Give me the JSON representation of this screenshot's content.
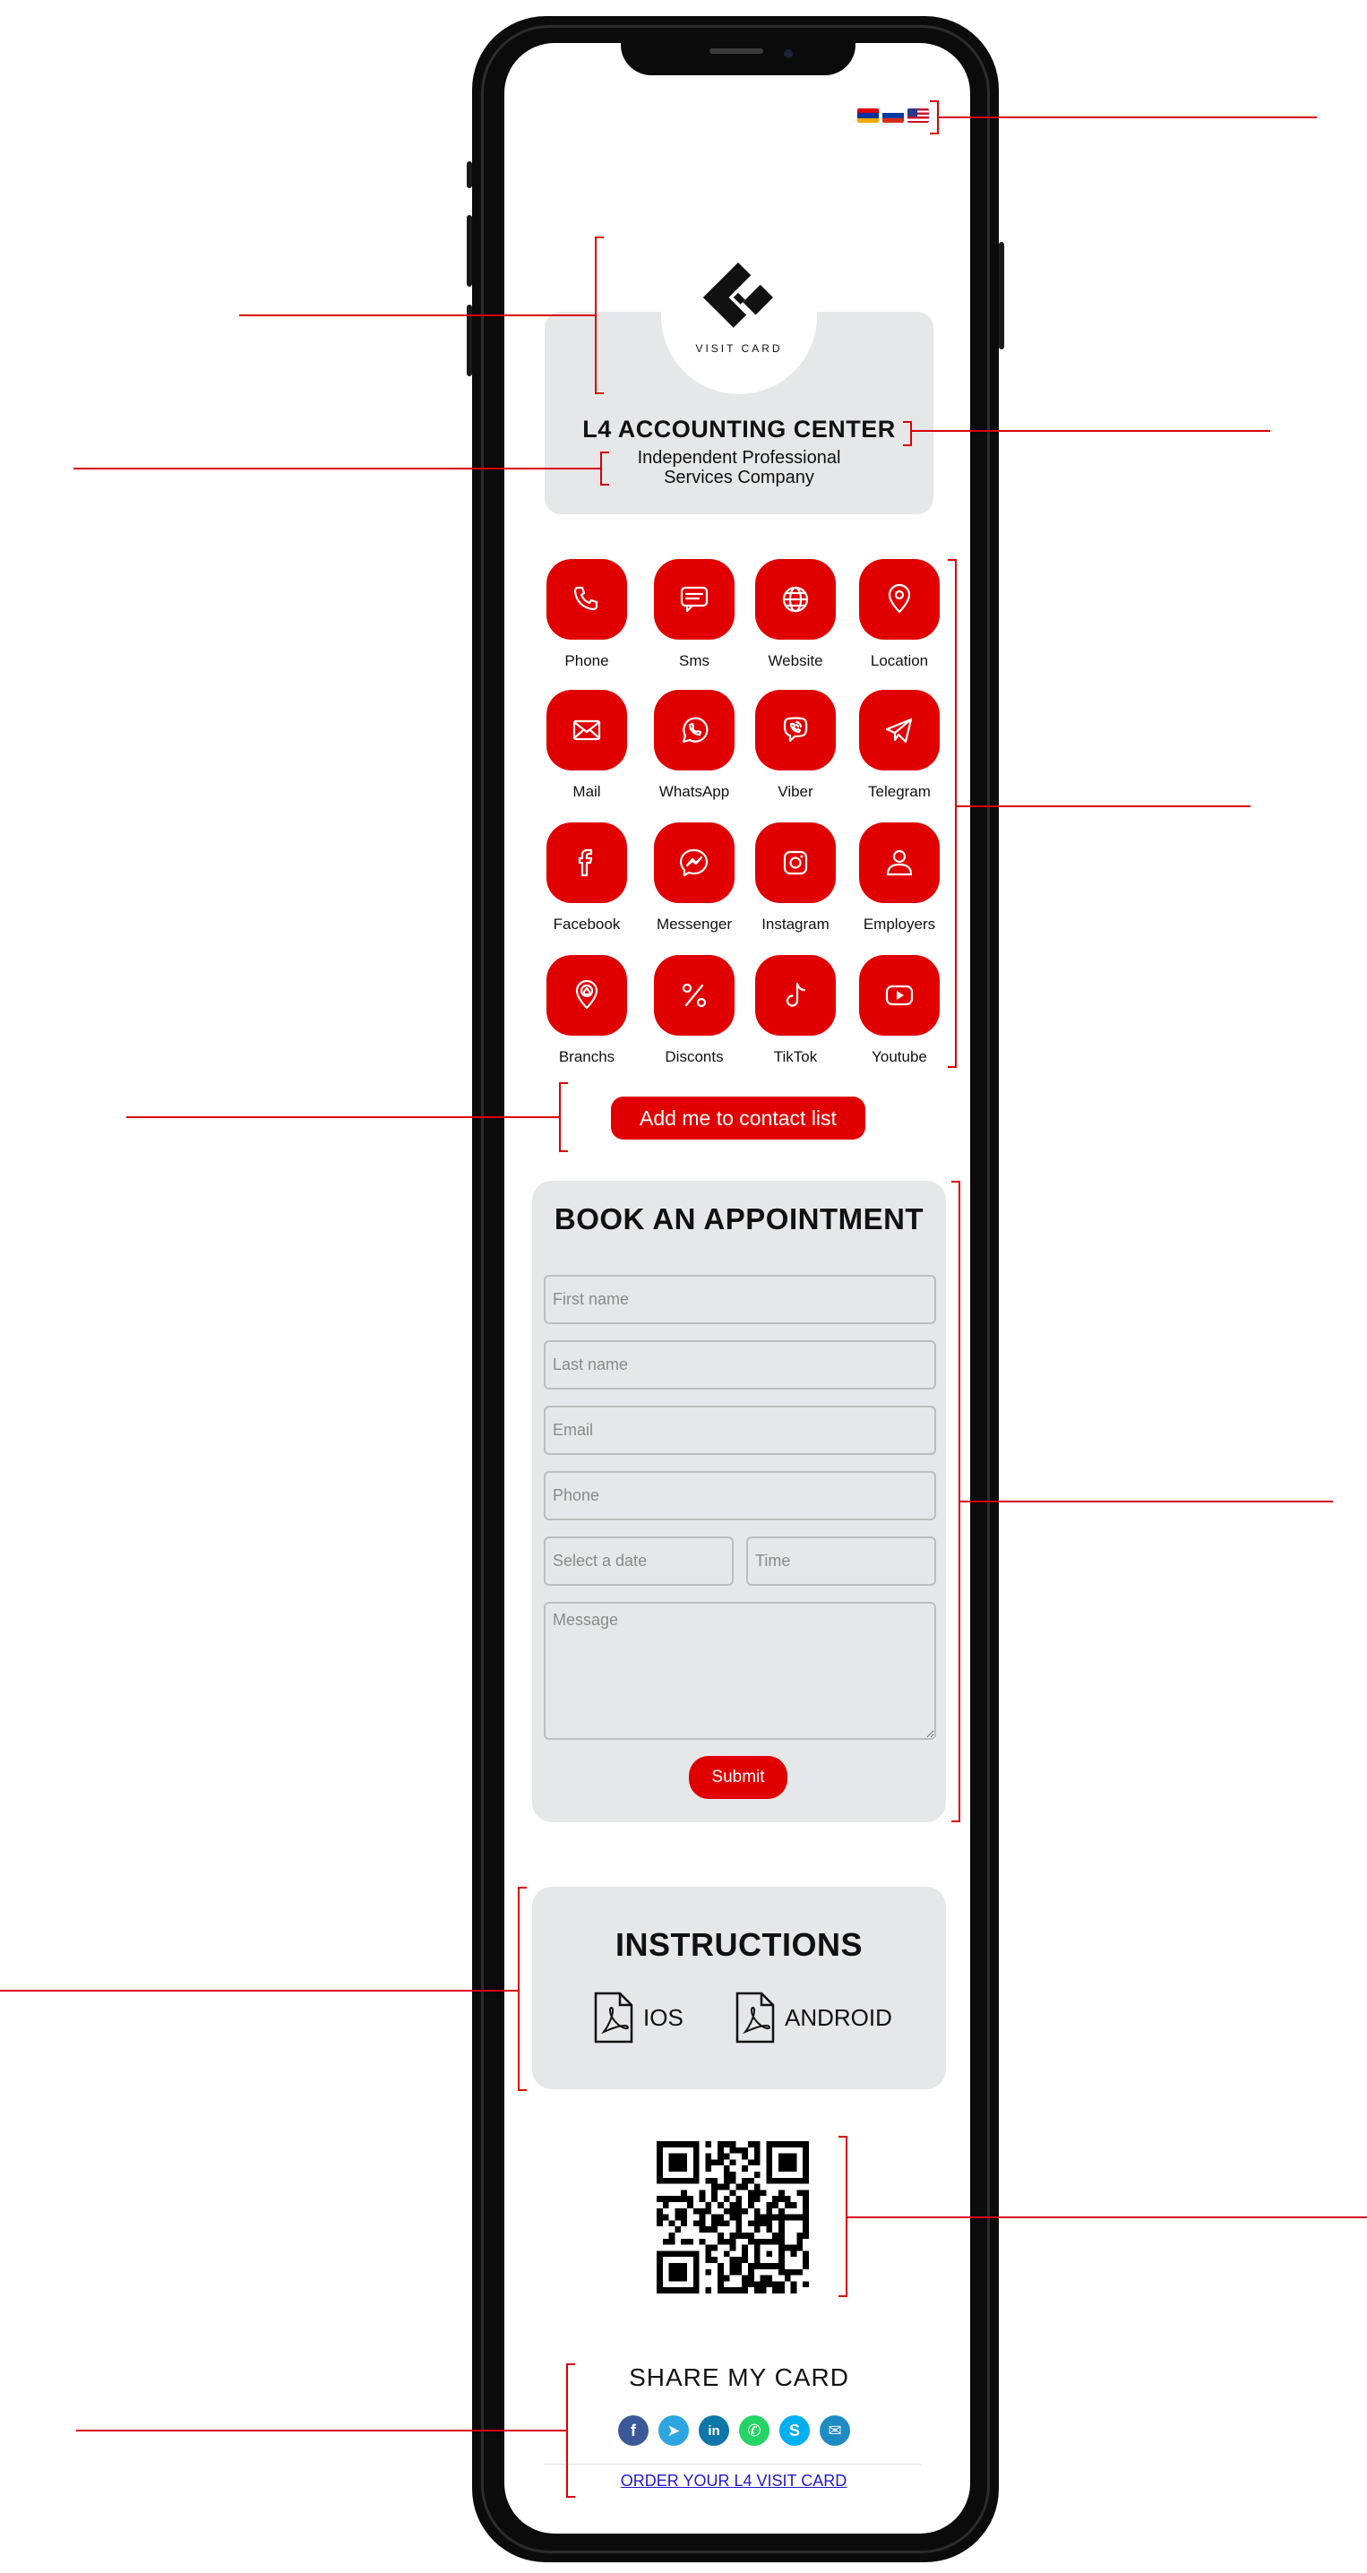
{
  "colors": {
    "accent": "#e00000",
    "card_bg": "#e6e7e8",
    "annotation": "#d90000",
    "link": "#2319c8"
  },
  "flags": [
    {
      "name": "armenia-flag-icon",
      "stripes": [
        "#d90012",
        "#0033a0",
        "#f2a800"
      ]
    },
    {
      "name": "russia-flag-icon",
      "stripes": [
        "#ffffff",
        "#0039a6",
        "#d52b1e"
      ]
    },
    {
      "name": "usa-flag-icon",
      "stripes": []
    }
  ],
  "header": {
    "logo_caption": "VISIT CARD",
    "company_name": "L4 ACCOUNTING CENTER",
    "company_sub_line1": "Independent Professional",
    "company_sub_line2": "Services Company"
  },
  "contacts": [
    {
      "label": "Phone",
      "icon": "phone-icon"
    },
    {
      "label": "Sms",
      "icon": "sms-icon"
    },
    {
      "label": "Website",
      "icon": "globe-icon"
    },
    {
      "label": "Location",
      "icon": "location-pin-icon"
    },
    {
      "label": "Mail",
      "icon": "mail-icon"
    },
    {
      "label": "WhatsApp",
      "icon": "whatsapp-icon"
    },
    {
      "label": "Viber",
      "icon": "viber-icon"
    },
    {
      "label": "Telegram",
      "icon": "telegram-icon"
    },
    {
      "label": "Facebook",
      "icon": "facebook-icon"
    },
    {
      "label": "Messenger",
      "icon": "messenger-icon"
    },
    {
      "label": "Instagram",
      "icon": "instagram-icon"
    },
    {
      "label": "Employers",
      "icon": "user-icon"
    },
    {
      "label": "Branchs",
      "icon": "branch-pin-icon"
    },
    {
      "label": "Disconts",
      "icon": "percent-icon"
    },
    {
      "label": "TikTok",
      "icon": "tiktok-icon"
    },
    {
      "label": "Youtube",
      "icon": "youtube-icon"
    }
  ],
  "add_contact_label": "Add me to contact list",
  "appointment": {
    "title": "BOOK AN APPOINTMENT",
    "first_name_placeholder": "First name",
    "last_name_placeholder": "Last name",
    "email_placeholder": "Email",
    "phone_placeholder": "Phone",
    "date_placeholder": "Select a date",
    "time_placeholder": "Time",
    "message_placeholder": "Message",
    "submit_label": "Submit"
  },
  "instructions": {
    "title": "INSTRUCTIONS",
    "ios_label": "IOS",
    "android_label": "ANDROID"
  },
  "share": {
    "title": "SHARE MY CARD",
    "buttons": [
      {
        "name": "facebook",
        "glyph": "f",
        "color": "#3b5998"
      },
      {
        "name": "telegram",
        "glyph": "➤",
        "color": "#2ca5e0"
      },
      {
        "name": "linkedin",
        "glyph": "in",
        "color": "#0e76a8"
      },
      {
        "name": "whatsapp",
        "glyph": "✆",
        "color": "#25d366"
      },
      {
        "name": "skype",
        "glyph": "S",
        "color": "#00aff0"
      },
      {
        "name": "email",
        "glyph": "✉",
        "color": "#1e8bc3"
      }
    ],
    "order_link": "ORDER YOUR L4 VISIT CARD"
  }
}
